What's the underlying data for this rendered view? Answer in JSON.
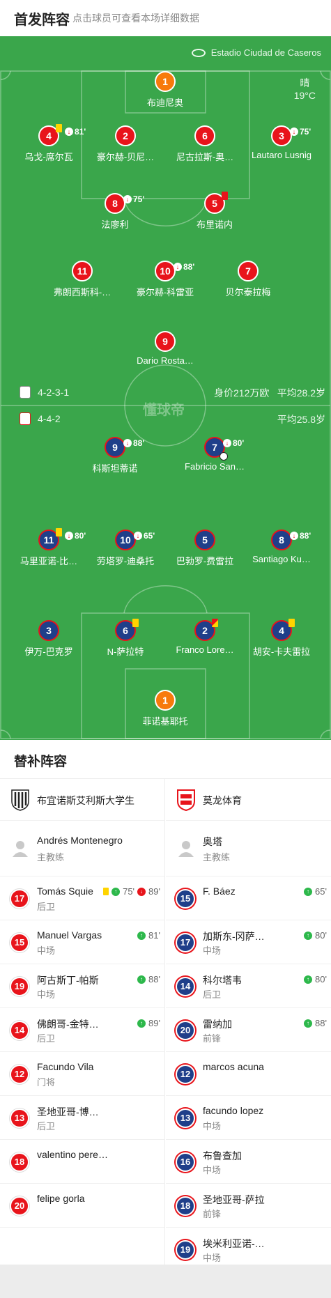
{
  "header": {
    "title": "首发阵容",
    "subtitle": "点击球员可查看本场详细数据"
  },
  "pitch": {
    "stadium": "Estadio Ciudad de Caseros",
    "weather": {
      "condition": "晴",
      "temp": "19°C"
    },
    "watermark": "懂球帝",
    "home_formation": "4-2-3-1",
    "home_value": "身价212万欧",
    "home_avg_age": "平均28.2岁",
    "away_formation": "4-4-2",
    "away_avg_age": "平均25.8岁"
  },
  "home_players": [
    {
      "num": "1",
      "name": "布迪尼奥"
    },
    {
      "num": "4",
      "name": "乌戈-席尔瓦",
      "sub": "81'"
    },
    {
      "num": "2",
      "name": "豪尔赫-贝尼…"
    },
    {
      "num": "6",
      "name": "尼古拉斯-奥…"
    },
    {
      "num": "3",
      "name": "Lautaro Lusnig",
      "sub": "75'"
    },
    {
      "num": "8",
      "name": "法廖利",
      "sub": "75'"
    },
    {
      "num": "5",
      "name": "布里诺内"
    },
    {
      "num": "11",
      "name": "弗朗西斯科-…"
    },
    {
      "num": "10",
      "name": "豪尔赫-科雷亚",
      "sub": "88'"
    },
    {
      "num": "7",
      "name": "贝尔泰拉梅"
    },
    {
      "num": "9",
      "name": "Dario Rosta…"
    }
  ],
  "away_players": [
    {
      "num": "9",
      "name": "科斯坦蒂诺",
      "sub": "88'"
    },
    {
      "num": "7",
      "name": "Fabricio San…",
      "sub": "80'"
    },
    {
      "num": "11",
      "name": "马里亚诺-比…",
      "sub": "80'"
    },
    {
      "num": "10",
      "name": "劳塔罗-迪桑托",
      "sub": "65'"
    },
    {
      "num": "5",
      "name": "巴勃罗-费雷拉"
    },
    {
      "num": "8",
      "name": "Santiago Ku…",
      "sub": "88'"
    },
    {
      "num": "3",
      "name": "伊万-巴克罗"
    },
    {
      "num": "6",
      "name": "N-萨拉特"
    },
    {
      "num": "2",
      "name": "Franco Lore…"
    },
    {
      "num": "4",
      "name": "胡安-卡夫雷拉"
    },
    {
      "num": "1",
      "name": "菲诺基耶托"
    }
  ],
  "subs_title": "替补阵容",
  "home": {
    "team": "布宜诺斯艾利斯大学生",
    "coach": "Andrés Montenegro",
    "coach_role": "主教练",
    "subs": [
      {
        "num": "17",
        "name": "Tomás Squie",
        "pos": "后卫",
        "in": "75'",
        "out": "89'"
      },
      {
        "num": "15",
        "name": "Manuel Vargas",
        "pos": "中场",
        "in": "81'"
      },
      {
        "num": "19",
        "name": "阿古斯丁-帕斯",
        "pos": "中场",
        "in": "88'"
      },
      {
        "num": "14",
        "name": "佛朗哥-金特…",
        "pos": "后卫",
        "in": "89'"
      },
      {
        "num": "12",
        "name": "Facundo Vila",
        "pos": "门将"
      },
      {
        "num": "13",
        "name": "圣地亚哥-博…",
        "pos": "后卫"
      },
      {
        "num": "18",
        "name": "valentino pere…",
        "pos": ""
      },
      {
        "num": "20",
        "name": "felipe gorla",
        "pos": ""
      }
    ]
  },
  "away": {
    "team": "莫龙体育",
    "coach": "奥塔",
    "coach_role": "主教练",
    "subs": [
      {
        "num": "15",
        "name": "F. Báez",
        "pos": "",
        "in": "65'"
      },
      {
        "num": "17",
        "name": "加斯东-冈萨…",
        "pos": "中场",
        "in": "80'"
      },
      {
        "num": "14",
        "name": "科尔塔韦",
        "pos": "后卫",
        "in": "80'"
      },
      {
        "num": "20",
        "name": "雷纳加",
        "pos": "前锋",
        "in": "88'"
      },
      {
        "num": "12",
        "name": "marcos acuna",
        "pos": ""
      },
      {
        "num": "13",
        "name": "facundo lopez",
        "pos": "中场"
      },
      {
        "num": "16",
        "name": "布鲁查加",
        "pos": "中场"
      },
      {
        "num": "18",
        "name": "圣地亚哥-萨拉",
        "pos": "前锋"
      },
      {
        "num": "19",
        "name": "埃米利亚诺-…",
        "pos": "中场"
      }
    ]
  }
}
